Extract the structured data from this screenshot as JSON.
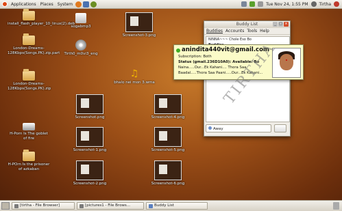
{
  "top_panel": {
    "menus": [
      "Applications",
      "Places",
      "System"
    ],
    "clock": "Tue Nov 24,  1:55 PM",
    "user": "Tirtha"
  },
  "desktop_icons": [
    {
      "label": "install_flash_player_10_linux(2).deb",
      "kind": "folder"
    },
    {
      "label": "London-Dreams-128Kbps(Songs.PK).zip.part",
      "kind": "folder"
    },
    {
      "label": "London-Dreams-128Kbps(Songs.PK).zip",
      "kind": "folder"
    },
    {
      "label": "H-Porn Is The goblet of fire",
      "kind": "drive"
    },
    {
      "label": "H-POrn Is the prisoner of azkaban",
      "kind": "folder"
    },
    {
      "label": "sogabmp3",
      "kind": "archive"
    },
    {
      "label": "Tirth0_m0vi3_eng",
      "kind": "dvd"
    },
    {
      "label": "Screenshot-3.png",
      "kind": "thumb"
    },
    {
      "label": "bhalo nei mon 3.wma",
      "kind": "music"
    },
    {
      "label": "Screenshot.png",
      "kind": "thumb"
    },
    {
      "label": "Screenshot-4.png",
      "kind": "thumb"
    },
    {
      "label": "Screenshot-1.png",
      "kind": "thumb"
    },
    {
      "label": "Screenshot-5.png",
      "kind": "thumb"
    },
    {
      "label": "Screenshot-2.png",
      "kind": "thumb"
    },
    {
      "label": "Screenshot-6.png",
      "kind": "thumb"
    }
  ],
  "buddy_list": {
    "title": "Buddy List",
    "menus": [
      "Buddies",
      "Accounts",
      "Tools",
      "Help"
    ],
    "rows": [
      {
        "text": "NINNA~~~ Chole Eso Bo",
        "group": false
      },
      {
        "text": "Buddies",
        "group": true
      }
    ],
    "status": "Away"
  },
  "tooltip": {
    "name": "anindita440vit@gmail.com",
    "lines": [
      "Subscription: Both",
      "Status (gmail.236D10A0): Available: Bo",
      "Naina.....Our...Ek Kahani.... Thora Saa",
      "Baadal.....Thora Saa Paani.....Our...Ek Kahani..."
    ]
  },
  "watermark": "TIRTHA",
  "taskbar": [
    {
      "label": "[tirtha - File Browser]"
    },
    {
      "label": "[pictures1 - File Brows..."
    },
    {
      "label": "Buddy List"
    }
  ]
}
